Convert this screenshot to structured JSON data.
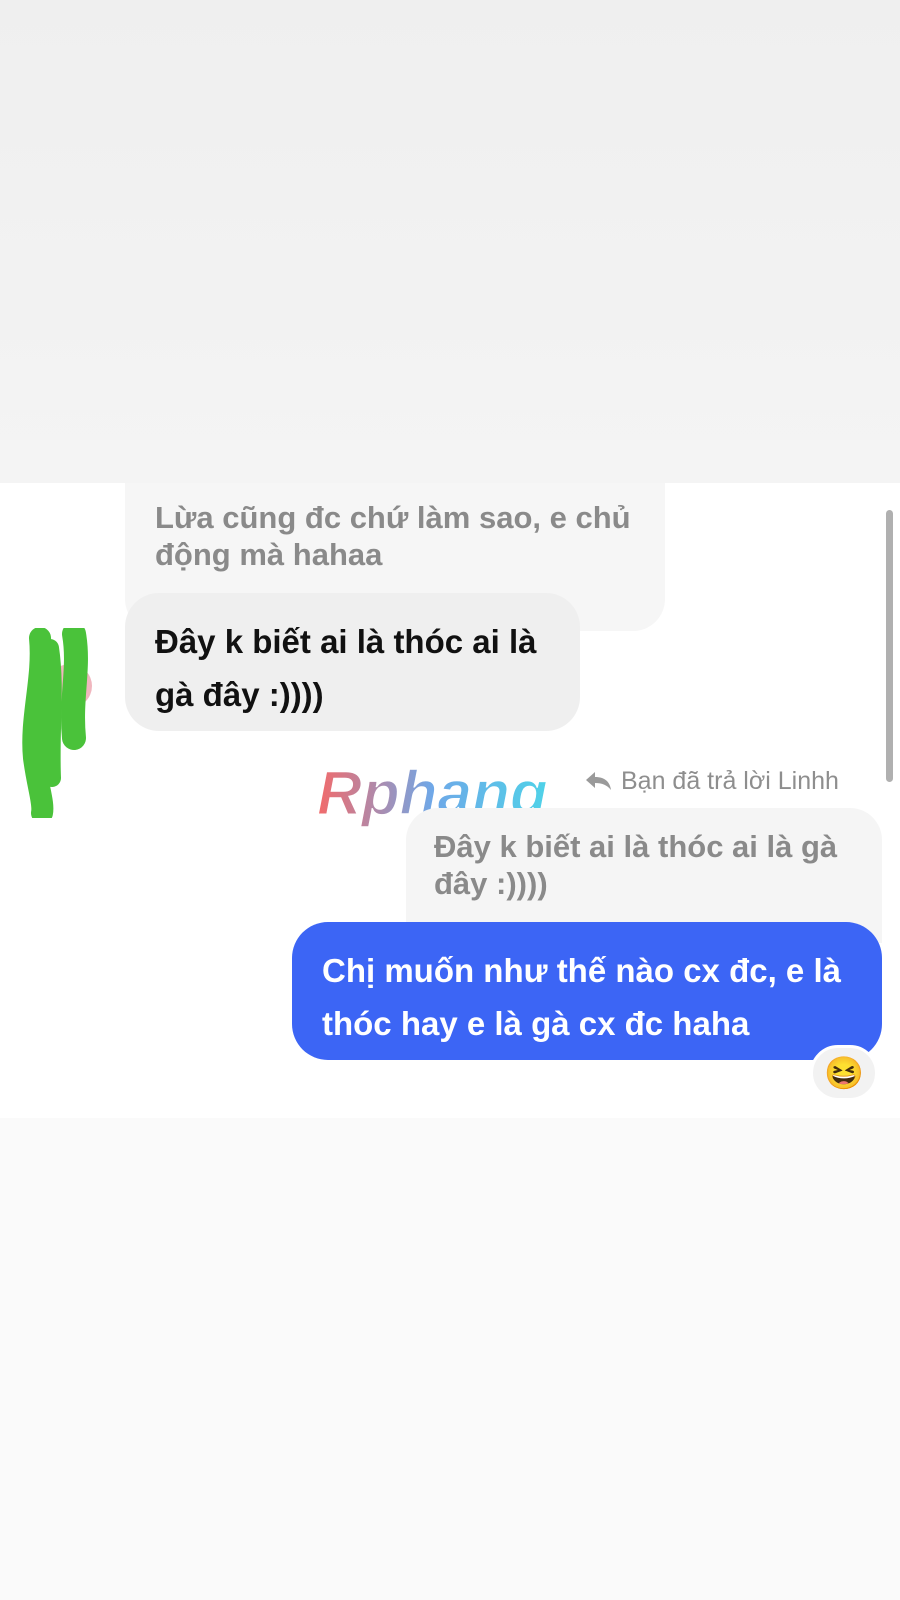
{
  "messages": {
    "quoted_top": "Lừa cũng đc chứ làm sao, e chủ động mà hahaa",
    "incoming": "Đây k biết ai là thóc ai là gà đây :))))",
    "reply_label": "Bạn đã trả lời Linhh",
    "quoted_reply": "Đây k biết ai là thóc ai là gà đây :))))",
    "outgoing": "Chị muốn như thế nào cx đc, e là thóc hay e là gà cx đc haha",
    "reaction": "😆"
  },
  "watermark": {
    "text": "Rphang"
  },
  "colors": {
    "outgoing_bubble": "#3c65f5",
    "incoming_bubble": "#efefef",
    "avatar_scribble": "#4ac23a"
  },
  "icons": {
    "reply": "reply-arrow-icon",
    "avatar": "avatar-redacted-icon"
  }
}
